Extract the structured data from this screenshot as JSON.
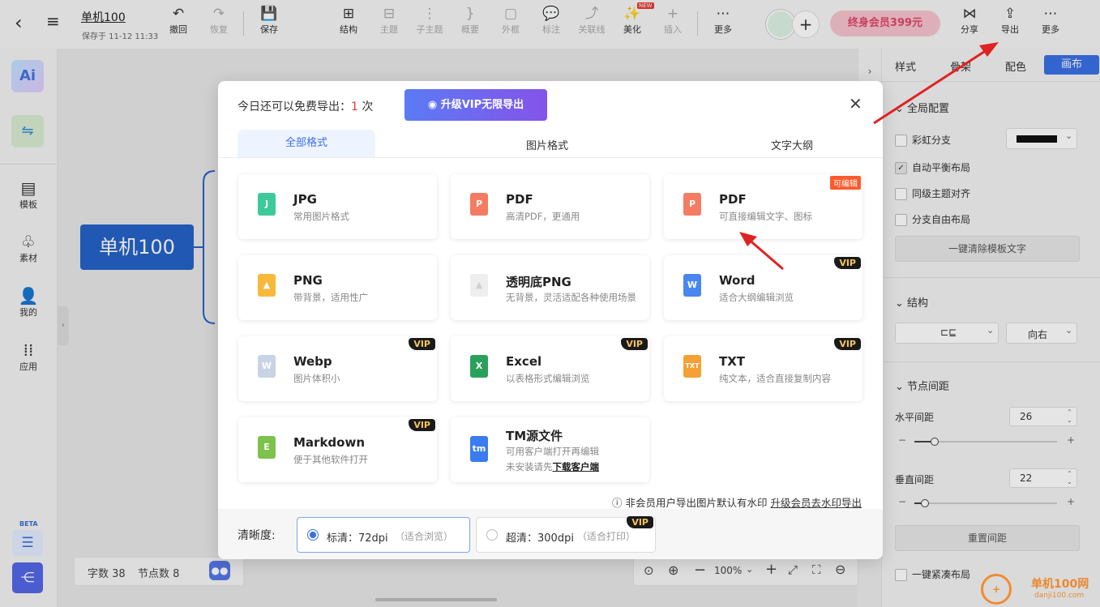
{
  "header": {
    "doc_title": "单机100",
    "save_status": "保存于 11-12 11:33",
    "left_tools": [
      {
        "label": "撤回",
        "icon": "undo-icon",
        "glyph": "↶"
      },
      {
        "label": "恢复",
        "icon": "redo-icon",
        "glyph": "↷"
      },
      {
        "label": "保存",
        "icon": "save-icon",
        "glyph": "💾"
      }
    ],
    "center_tools": [
      {
        "label": "结构",
        "icon": "structure-icon",
        "glyph": "⊞"
      },
      {
        "label": "主题",
        "icon": "topic-icon",
        "glyph": "⊟"
      },
      {
        "label": "子主题",
        "icon": "subtopic-icon",
        "glyph": "⋮"
      },
      {
        "label": "概要",
        "icon": "summary-icon",
        "glyph": "}"
      },
      {
        "label": "外框",
        "icon": "boundary-icon",
        "glyph": "▢"
      },
      {
        "label": "标注",
        "icon": "callout-icon",
        "glyph": "💬"
      },
      {
        "label": "关联线",
        "icon": "relation-icon",
        "glyph": "⤴"
      },
      {
        "label": "美化",
        "icon": "beautify-icon",
        "glyph": "✨"
      },
      {
        "label": "插入",
        "icon": "insert-icon",
        "glyph": "+"
      },
      {
        "label": "更多",
        "icon": "more-icon",
        "glyph": "⋯"
      }
    ],
    "new_badge": "NEW",
    "vip_promo": "终身会员399元",
    "right_tools": [
      {
        "label": "分享",
        "icon": "share-icon",
        "glyph": "⋈"
      },
      {
        "label": "导出",
        "icon": "export-icon",
        "glyph": "⇪"
      },
      {
        "label": "更多",
        "icon": "more-icon",
        "glyph": "⋯"
      }
    ]
  },
  "left_sidebar": {
    "items": [
      {
        "label": "模板",
        "icon": "template-icon",
        "glyph": "▤"
      },
      {
        "label": "素材",
        "icon": "material-icon",
        "glyph": "♧"
      },
      {
        "label": "我的",
        "icon": "mine-icon",
        "glyph": "👤"
      },
      {
        "label": "应用",
        "icon": "apps-icon",
        "glyph": "⁞⁞"
      }
    ],
    "beta": "BETA"
  },
  "canvas": {
    "root_node": "单机100",
    "status": {
      "word_count": "字数 38",
      "node_count": "节点数 8"
    },
    "zoom": "100%"
  },
  "right_panel": {
    "tabs": [
      "样式",
      "骨架",
      "配色",
      "画布"
    ],
    "active_tab": "画布",
    "global_section": "全局配置",
    "checks": [
      "彩虹分支",
      "自动平衡布局",
      "同级主题对齐",
      "分支自由布局"
    ],
    "clear_btn": "一键清除模板文字",
    "structure_section": "结构",
    "direction": "向右",
    "spacing_section": "节点间距",
    "h_label": "水平间距",
    "h_value": "26",
    "v_label": "垂直间距",
    "v_value": "22",
    "reset_btn": "重置间距",
    "compact": "一键紧凑布局"
  },
  "dialog": {
    "quota_prefix": "今日还可以免费导出：",
    "quota_count": "1",
    "quota_suffix": "次",
    "upgrade_btn": "升级VIP无限导出",
    "tabs": [
      "全部格式",
      "图片格式",
      "文字大纲"
    ],
    "active_tab": "全部格式",
    "formats": [
      {
        "name": "JPG",
        "desc": "常用图片格式",
        "color": "#3ec99a",
        "letter": "J",
        "badge": ""
      },
      {
        "name": "PDF",
        "desc": "高清PDF，更通用",
        "color": "#f47c62",
        "letter": "P",
        "badge": ""
      },
      {
        "name": "PDF",
        "desc": "可直接编辑文字、图标",
        "color": "#f47c62",
        "letter": "P",
        "badge": "可编辑"
      },
      {
        "name": "PNG",
        "desc": "带背景，适用性广",
        "color": "#f8b93b",
        "letter": "▲",
        "badge": ""
      },
      {
        "name": "透明底PNG",
        "desc": "无背景，灵活适配各种使用场景",
        "color": "#dddddd",
        "letter": "▲",
        "badge": ""
      },
      {
        "name": "Word",
        "desc": "适合大纲编辑浏览",
        "color": "#4a86f0",
        "letter": "W",
        "badge": "VIP"
      },
      {
        "name": "Webp",
        "desc": "图片体积小",
        "color": "#c8d3e3",
        "letter": "W",
        "badge": "VIP"
      },
      {
        "name": "Excel",
        "desc": "以表格形式编辑浏览",
        "color": "#2aa15b",
        "letter": "X",
        "badge": "VIP"
      },
      {
        "name": "TXT",
        "desc": "纯文本，适合直接复制内容",
        "color": "#f5a035",
        "letter": "TXT",
        "badge": "VIP"
      },
      {
        "name": "Markdown",
        "desc": "便于其他软件打开",
        "color": "#7cc24b",
        "letter": "E",
        "badge": "VIP"
      },
      {
        "name": "TM源文件",
        "desc": "可用客户端打开再编辑",
        "color": "#3a7cf0",
        "letter": "tm",
        "badge": ""
      }
    ],
    "tm_note": "未安装请先",
    "tm_link": "下载客户端",
    "watermark_note": "非会员用户导出图片默认有水印",
    "watermark_link": "升级会员去水印导出",
    "clarity_label": "清晰度:",
    "clarity_options": [
      {
        "label": "标清：72dpi",
        "hint": "（适合浏览）",
        "selected": true
      },
      {
        "label": "超清：300dpi",
        "hint": "（适合打印）",
        "selected": false
      }
    ],
    "vip": "VIP"
  },
  "watermark": "单机100网",
  "watermark_url": "danji100.com"
}
